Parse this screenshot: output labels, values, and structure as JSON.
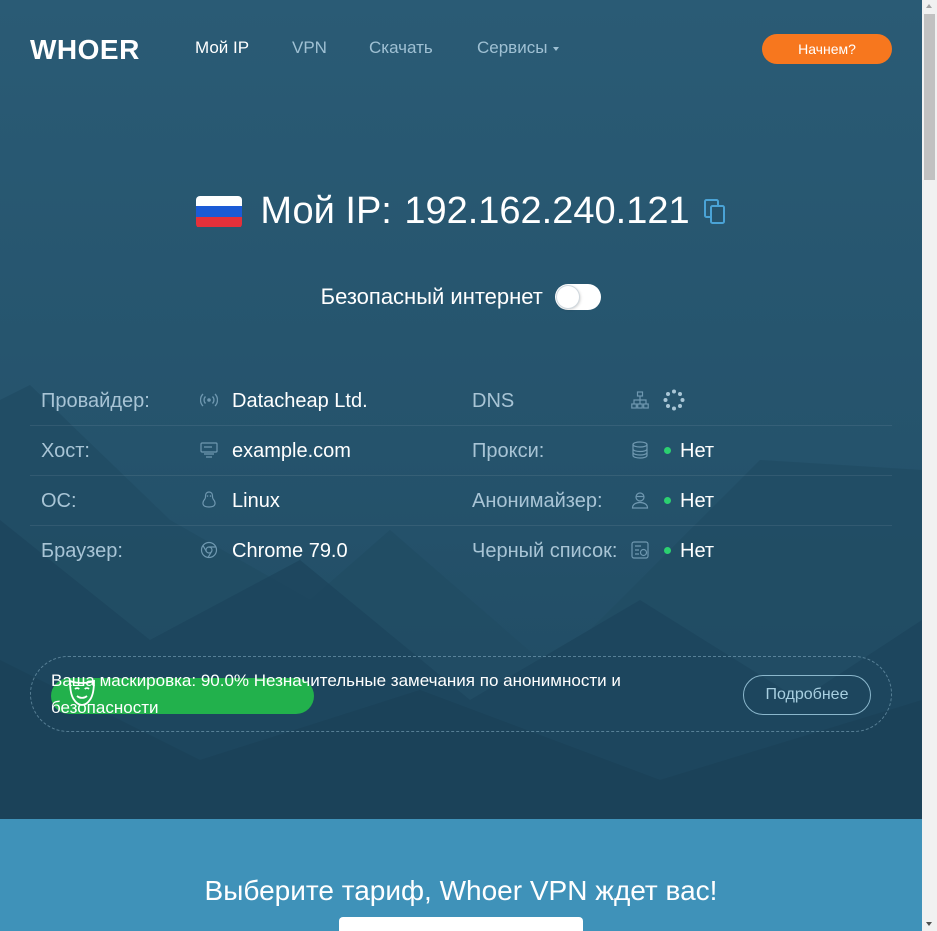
{
  "nav": {
    "logo": "WHOER",
    "items": [
      {
        "label": "Мой IP",
        "active": true
      },
      {
        "label": "VPN",
        "active": false
      },
      {
        "label": "Скачать",
        "active": false
      },
      {
        "label": "Сервисы",
        "active": false,
        "dropdown": true
      }
    ],
    "cta": "Начнем?"
  },
  "ip": {
    "label": "Мой IP:",
    "value": "192.162.240.121",
    "flag_colors": [
      "#ffffff",
      "#1b5bd6",
      "#e5303a"
    ],
    "copy_icon": "copy-icon"
  },
  "secure": {
    "label": "Безопасный интернет",
    "enabled": false
  },
  "info": {
    "left": [
      {
        "label": "Провайдер:",
        "icon": "antenna-icon",
        "value": "Datacheap Ltd."
      },
      {
        "label": "Хост:",
        "icon": "server-icon",
        "value": "example.com"
      },
      {
        "label": "ОС:",
        "icon": "linux-icon",
        "value": "Linux"
      },
      {
        "label": "Браузер:",
        "icon": "browser-icon",
        "value": "Chrome 79.0"
      }
    ],
    "right": [
      {
        "label": "DNS",
        "icon": "network-icon",
        "value": "",
        "loading": true
      },
      {
        "label": "Прокси:",
        "icon": "database-icon",
        "value": "Нет"
      },
      {
        "label": "Анонимайзер:",
        "icon": "user-icon",
        "value": "Нет"
      },
      {
        "label": "Черный список:",
        "icon": "blacklist-icon",
        "value": "Нет"
      }
    ]
  },
  "mask": {
    "text": "Ваша маскировка: 90.0% Незначительные замечания по анонимности и безопасности",
    "percent": 90.0,
    "button": "Подробнее",
    "color": "#22b14c"
  },
  "tariff": {
    "title": "Выберите тариф, Whoer VPN ждет вас!"
  },
  "colors": {
    "accent": "#f7771e",
    "hero": "#25536c",
    "status_ok": "#2bd070",
    "tariff_bg": "#3f92b9"
  }
}
